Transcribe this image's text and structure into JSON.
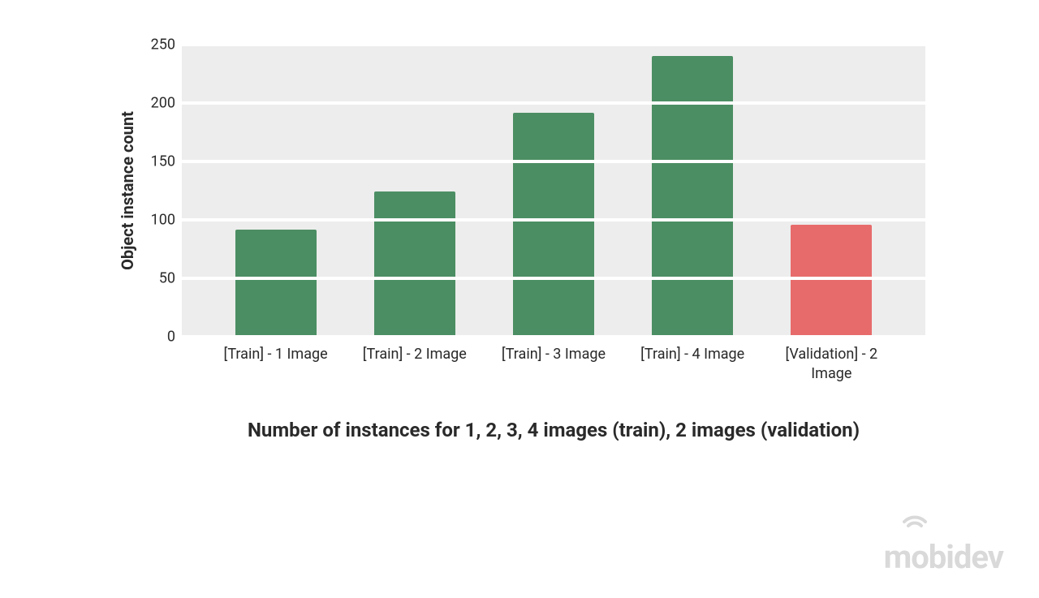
{
  "chart_data": {
    "type": "bar",
    "categories": [
      "[Train] - 1 Image",
      "[Train] - 2 Image",
      "[Train] - 3 Image",
      "[Train] - 4 Image",
      "[Validation] - 2 Image"
    ],
    "values": [
      92,
      124,
      192,
      240,
      96
    ],
    "colors": [
      "#4b8e63",
      "#4b8e63",
      "#4b8e63",
      "#4b8e63",
      "#e76b6b"
    ],
    "title": "Number of instances for 1, 2, 3, 4 images (train), 2 images (validation)",
    "xlabel": "",
    "ylabel": "Object instance count",
    "ylim": [
      0,
      250
    ],
    "yticks": [
      0,
      50,
      100,
      150,
      200,
      250
    ]
  },
  "branding": {
    "logo_text": "mobidev"
  }
}
